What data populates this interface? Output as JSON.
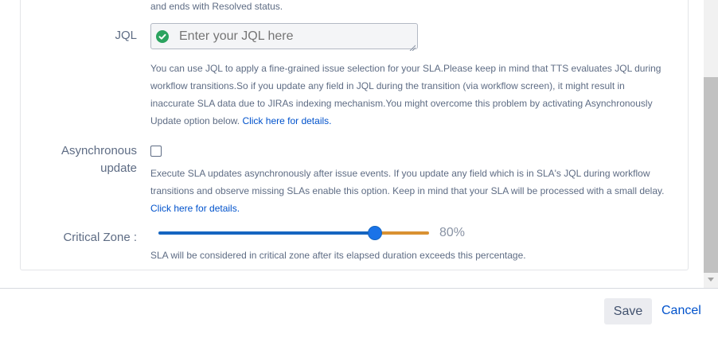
{
  "top_partial_text": "and ends with Resolved status.",
  "jql": {
    "label": "JQL",
    "placeholder": "Enter your JQL here",
    "valid_icon": "check-circle-icon",
    "help_lines": [
      "You can use JQL to apply a fine-grained issue selection for your SLA.Please keep in mind that TTS evaluates JQL during",
      "workflow transitions.So if you update any field in JQL during the transition (via workflow screen), it might result in",
      "inaccurate SLA data due to JIRAs indexing mechanism.You might overcome this problem by activating Asynchronously",
      "Update option below."
    ],
    "help_link": "Click here for details."
  },
  "async": {
    "label_line1": "Asynchronous",
    "label_line2": "update",
    "checked": false,
    "help_lines": [
      "Execute SLA updates asynchronously after issue events. If you update any field which is in SLA's JQL during workflow",
      "transitions and observe missing SLAs enable this option. Keep in mind that your SLA will be processed with a small delay."
    ],
    "help_link": "Click here for details."
  },
  "critical_zone": {
    "label": "Critical Zone :",
    "value": 80,
    "value_text": "80%",
    "help": "SLA will be considered in critical zone after its elapsed duration exceeds this percentage.",
    "fill_color": "#1565c0",
    "rest_color": "#d99132"
  },
  "footer": {
    "save_label": "Save",
    "cancel_label": "Cancel"
  }
}
